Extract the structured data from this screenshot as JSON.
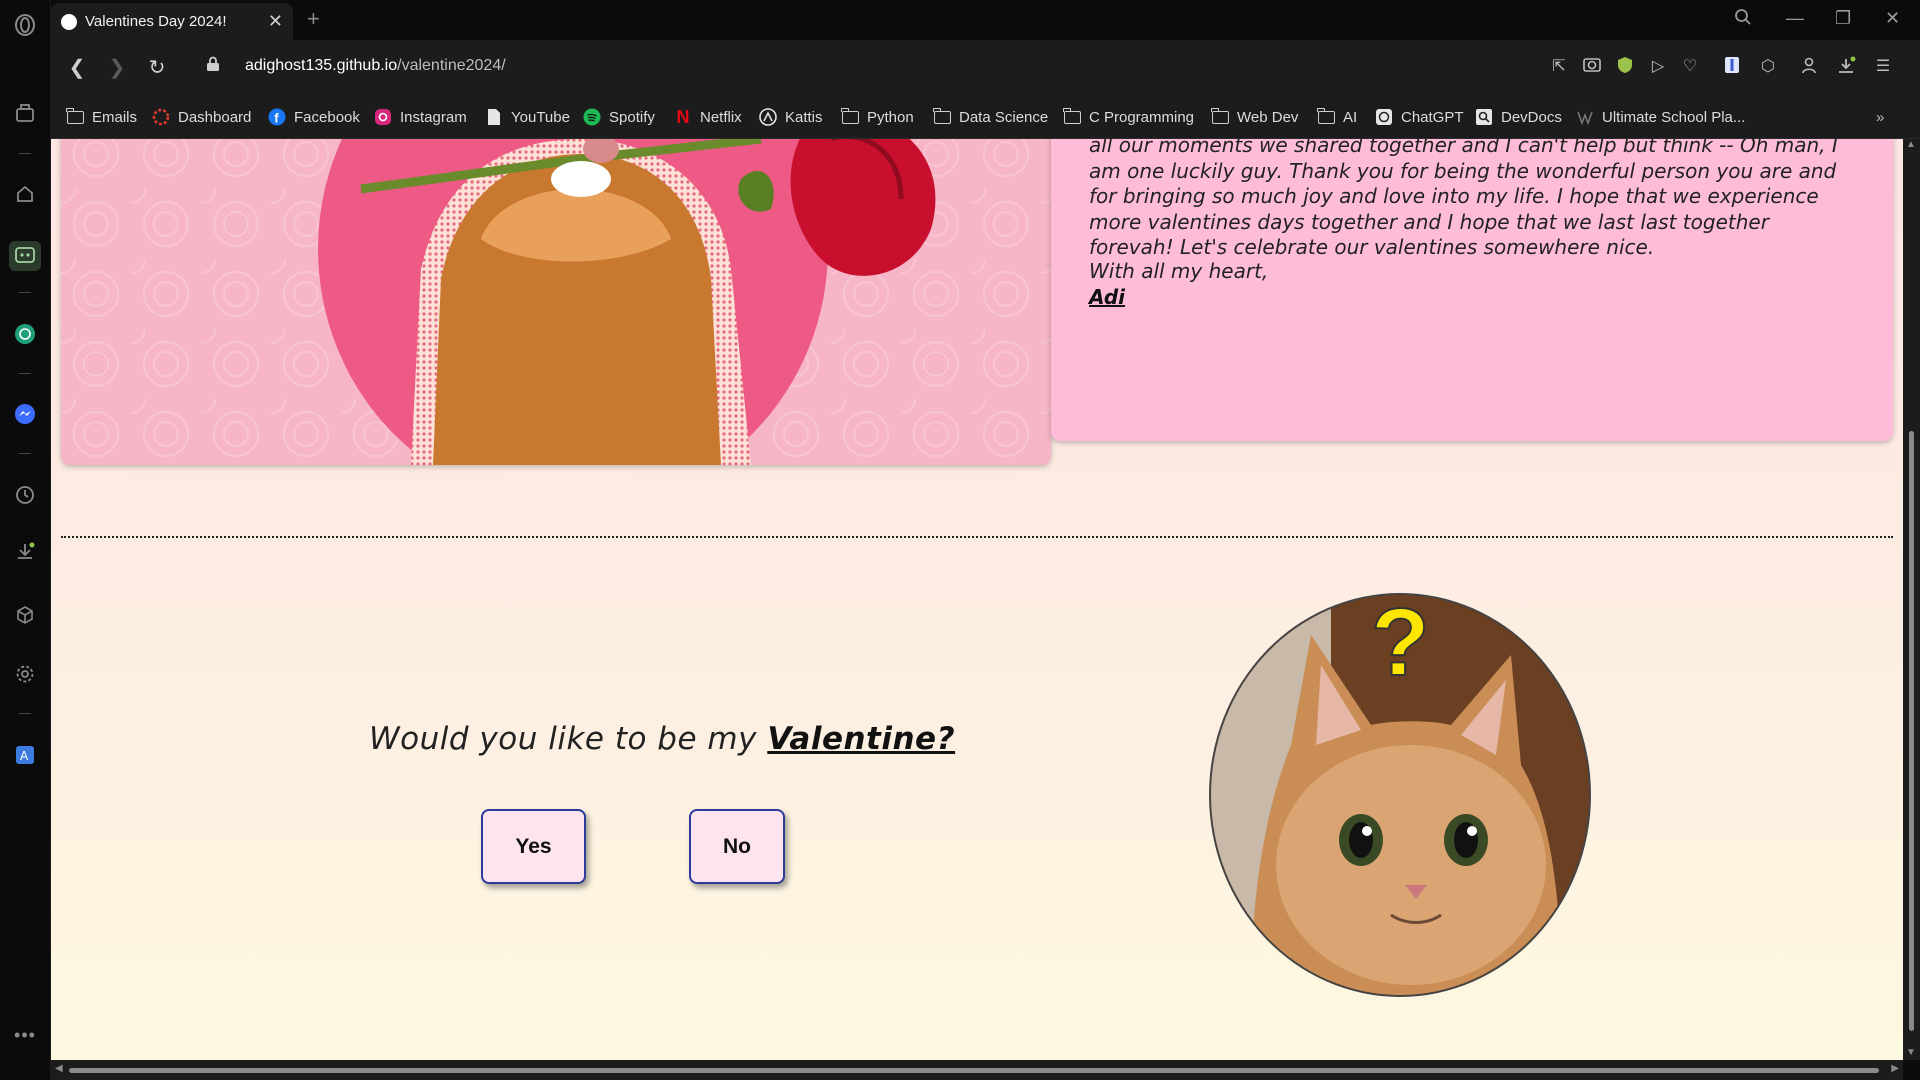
{
  "tab": {
    "title": "Valentines Day 2024!"
  },
  "address": {
    "url_host": "adighost135.github.io",
    "url_path": "/valentine2024/"
  },
  "bookmarks": [
    {
      "label": "Emails",
      "icon": "folder-icon"
    },
    {
      "label": "Dashboard",
      "icon": "dashboard-icon"
    },
    {
      "label": "Facebook",
      "icon": "facebook-icon"
    },
    {
      "label": "Instagram",
      "icon": "instagram-icon"
    },
    {
      "label": "YouTube",
      "icon": "page-icon"
    },
    {
      "label": "Spotify",
      "icon": "spotify-icon"
    },
    {
      "label": "Netflix",
      "icon": "netflix-icon"
    },
    {
      "label": "Kattis",
      "icon": "kattis-icon"
    },
    {
      "label": "Python",
      "icon": "folder-icon"
    },
    {
      "label": "Data Science",
      "icon": "folder-icon"
    },
    {
      "label": "C Programming",
      "icon": "folder-icon"
    },
    {
      "label": "Web Dev",
      "icon": "folder-icon"
    },
    {
      "label": "AI",
      "icon": "folder-icon"
    },
    {
      "label": "ChatGPT",
      "icon": "chatgpt-icon"
    },
    {
      "label": "DevDocs",
      "icon": "devdocs-icon"
    },
    {
      "label": "Ultimate School Pla...",
      "icon": "notion-icon"
    }
  ],
  "page": {
    "letter_text": "all our moments we shared together and I can't help but think -- Oh man, I am one luckily guy. Thank you for being the wonderful person you are and for bringing so much joy and love into my life. I hope that we experience more valentines days together and I hope that we last last together forevah! Let's celebrate our valentines somewhere nice.",
    "signoff": "With all my heart,",
    "signature": "Adi",
    "question": "Would you like to be my ",
    "question_emphasis": "Valentine?",
    "yes_label": "Yes",
    "no_label": "No"
  },
  "colors": {
    "photo_card": "#f6b6c8",
    "letter_card": "#ffbcd9",
    "button_bg": "#fde4ee",
    "button_border": "#2c3a99",
    "browser_bar": "#1c1c1c"
  }
}
